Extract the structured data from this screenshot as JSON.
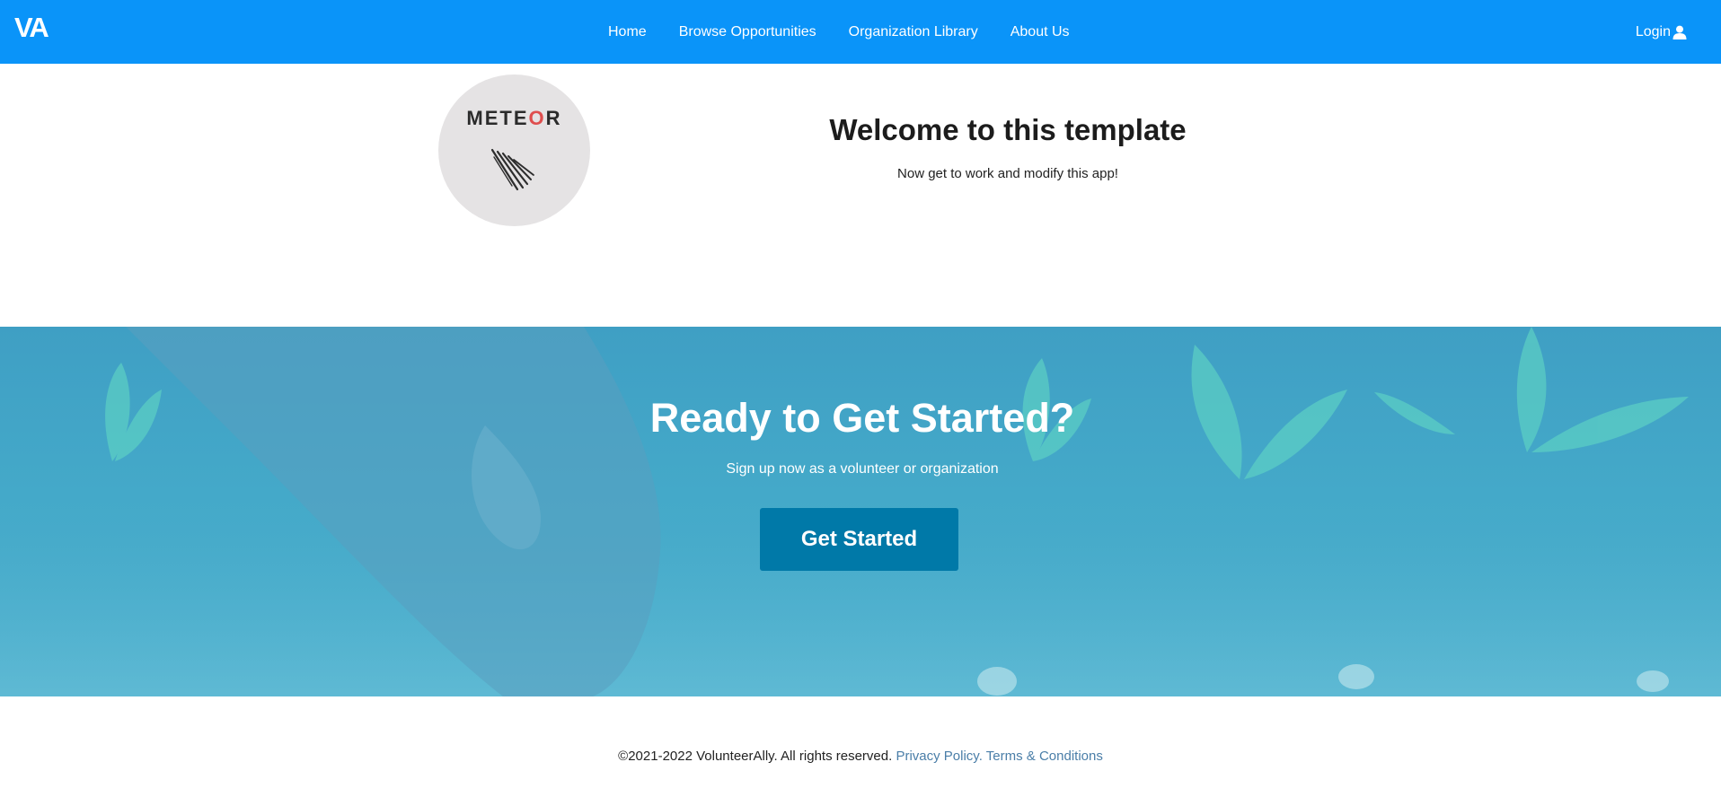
{
  "navbar": {
    "brand": "VA",
    "links": [
      "Home",
      "Browse Opportunities",
      "Organization Library",
      "About Us"
    ],
    "login_label": "Login",
    "background": "#0a94f9"
  },
  "hero": {
    "logo_text_before": "METE",
    "logo_text_o": "O",
    "logo_text_after": "R",
    "title": "Welcome to this template",
    "subtitle": "Now get to work and modify this app!"
  },
  "cta": {
    "title": "Ready to Get Started?",
    "subtitle": "Sign up now as a volunteer or organization",
    "button_label": "Get Started",
    "button_color": "#0079a8"
  },
  "footer": {
    "copyright": "©2021-2022 VolunteerAlly. All rights reserved.",
    "privacy_label": "Privacy Policy.",
    "terms_label": "Terms & Conditions"
  },
  "icons": {
    "user": "user-icon",
    "meteor": "meteor-logo-icon"
  }
}
